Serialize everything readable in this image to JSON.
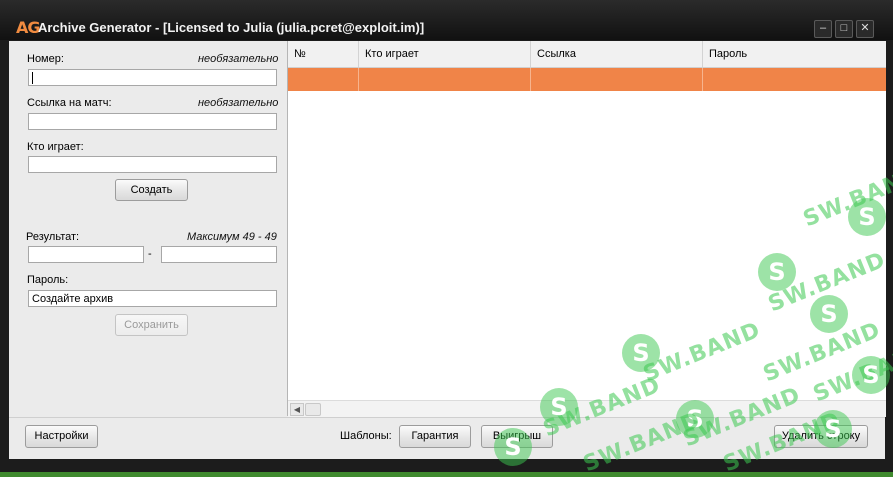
{
  "window": {
    "logo_text": "AG",
    "title": "Archive Generator - [Licensed to Julia (julia.pcret@exploit.im)]",
    "minimize_glyph": "–",
    "maximize_glyph": "□",
    "close_glyph": "✕"
  },
  "form": {
    "number_label": "Номер:",
    "number_hint": "необязательно",
    "number_value": "",
    "match_link_label": "Ссылка на матч:",
    "match_link_hint": "необязательно",
    "match_link_value": "",
    "who_plays_label": "Кто играет:",
    "who_plays_value": "",
    "create_button": "Создать",
    "result_label": "Результат:",
    "result_hint": "Максимум 49 - 49",
    "result_left_value": "",
    "result_separator": "-",
    "result_right_value": "",
    "password_label": "Пароль:",
    "password_value": "Создайте архив",
    "save_button": "Сохранить"
  },
  "table": {
    "columns": [
      "№",
      "Кто играет",
      "Ссылка",
      "Пароль"
    ],
    "selected_row_color": "#f08448"
  },
  "bottom_bar": {
    "settings_button": "Настройки",
    "templates_label": "Шаблоны:",
    "guarantee_button": "Гарантия",
    "win_button": "Выигрыш",
    "delete_row_button": "Удалить строку"
  },
  "watermark": {
    "text": "SW.BAND",
    "badge": "S",
    "color": "#3cc850"
  }
}
